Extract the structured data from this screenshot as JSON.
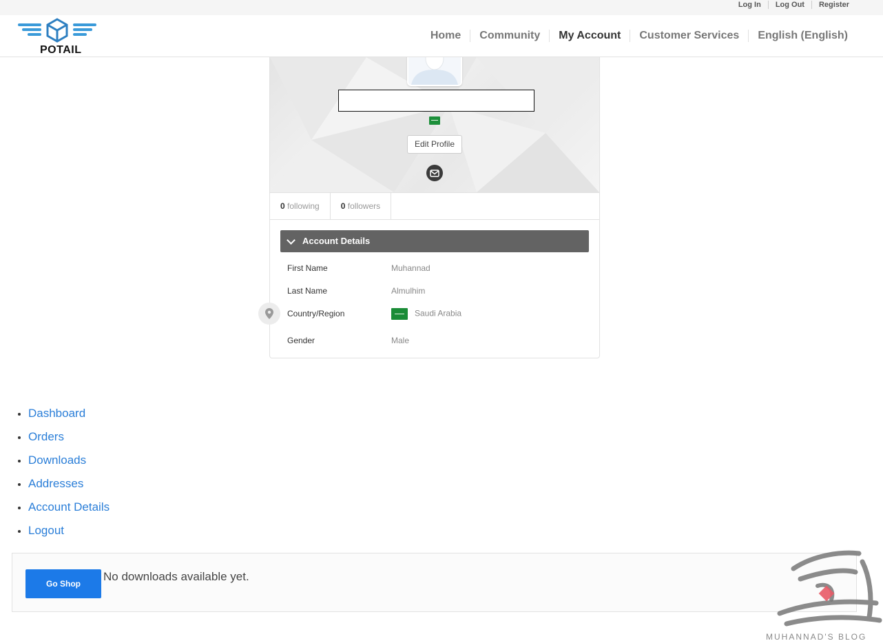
{
  "topbar": {
    "links": [
      "Log In",
      "Log Out",
      "Register"
    ]
  },
  "header": {
    "logo_text": "POTAIL",
    "nav": [
      "Home",
      "Community",
      "My Account",
      "Customer Services",
      "English (English)"
    ],
    "active_nav": "My Account"
  },
  "profile": {
    "edit_label": "Edit Profile",
    "following_count": "0",
    "following_label": "following",
    "followers_count": "0",
    "followers_label": "followers"
  },
  "account_details": {
    "title": "Account Details",
    "rows": [
      {
        "label": "First Name",
        "value": "Muhannad"
      },
      {
        "label": "Last Name",
        "value": "Almulhim"
      },
      {
        "label": "Country/Region",
        "value": "Saudi Arabia"
      },
      {
        "label": "Gender",
        "value": "Male"
      }
    ]
  },
  "account_nav": [
    "Dashboard",
    "Orders",
    "Downloads",
    "Addresses",
    "Account Details",
    "Logout"
  ],
  "downloads": {
    "button_label": "Go Shop",
    "message": "No downloads available yet."
  },
  "watermark": {
    "text": "MUHANNAD'S BLOG"
  },
  "colors": {
    "accent": "#1c7ae8",
    "link": "#2a7ed8",
    "panel_header": "#636363",
    "logo_blue": "#3a9ad9"
  }
}
